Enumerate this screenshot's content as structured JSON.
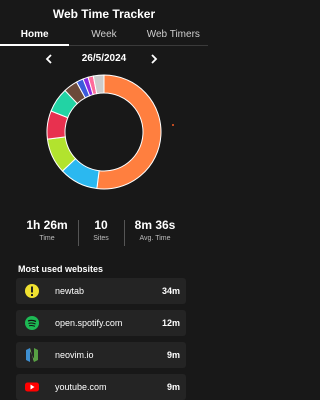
{
  "app": {
    "title": "Web Time Tracker"
  },
  "tabs": [
    {
      "label": "Home",
      "active": true
    },
    {
      "label": "Week",
      "active": false
    },
    {
      "label": "Web Timers",
      "active": false
    }
  ],
  "date_nav": {
    "date": "26/5/2024",
    "prev_icon": "chevron-left-icon",
    "next_icon": "chevron-right-icon"
  },
  "chart_data": {
    "type": "pie",
    "variant": "donut",
    "categories": [
      "orange",
      "sky",
      "lime",
      "red",
      "teal",
      "brown",
      "blue",
      "purple",
      "pink",
      "grey"
    ],
    "values": [
      52,
      11,
      10,
      8,
      7,
      4,
      2,
      1.5,
      1.5,
      3
    ],
    "colors": [
      "#ff7f3f",
      "#2bb8f0",
      "#b2e32e",
      "#e8314f",
      "#22d3a4",
      "#6b4a3a",
      "#3b5bdb",
      "#8a2be2",
      "#ff6b9a",
      "#cccccc"
    ]
  },
  "stats": [
    {
      "value": "1h 26m",
      "label": "Time"
    },
    {
      "value": "10",
      "label": "Sites"
    },
    {
      "value": "8m 36s",
      "label": "Avg. Time"
    }
  ],
  "most_used": {
    "title": "Most used websites",
    "sites": [
      {
        "name": "newtab",
        "time": "34m",
        "icon": "newtab-warning-icon",
        "color": "#f0e130"
      },
      {
        "name": "open.spotify.com",
        "time": "12m",
        "icon": "spotify-icon",
        "color": "#1db954"
      },
      {
        "name": "neovim.io",
        "time": "9m",
        "icon": "neovim-icon",
        "color": "#57a143"
      },
      {
        "name": "youtube.com",
        "time": "9m",
        "icon": "youtube-icon",
        "color": "#ff0000"
      }
    ]
  }
}
